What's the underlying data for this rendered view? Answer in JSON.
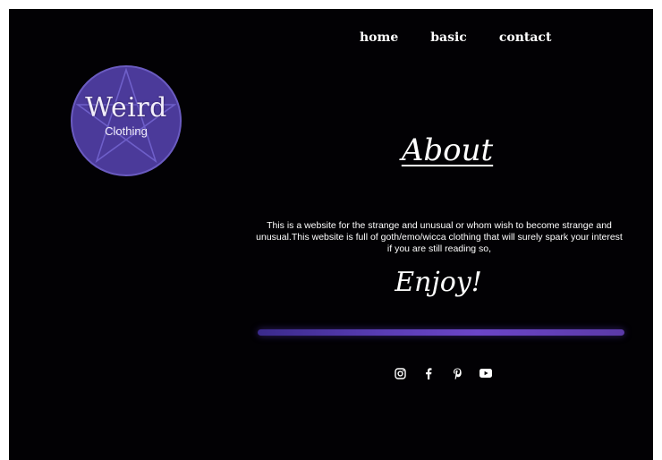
{
  "nav": {
    "items": [
      "home",
      "basic",
      "contact"
    ]
  },
  "logo": {
    "title": "Weird",
    "subtitle": "Clothing",
    "circle_color": "#4b3a9a",
    "ring_color": "#6a5bc0"
  },
  "about": {
    "heading": "About",
    "description": "This is a website for the strange and unusual or whom wish to become strange and unusual.This website is full of goth/emo/wicca clothing that will surely spark your interest if you are still reading so,",
    "closing": "Enjoy!"
  },
  "social": {
    "icons": [
      "instagram-icon",
      "facebook-icon",
      "pinterest-icon",
      "youtube-icon"
    ]
  },
  "colors": {
    "background": "#020104",
    "accent": "#5a3db5",
    "text": "#ffffff"
  }
}
